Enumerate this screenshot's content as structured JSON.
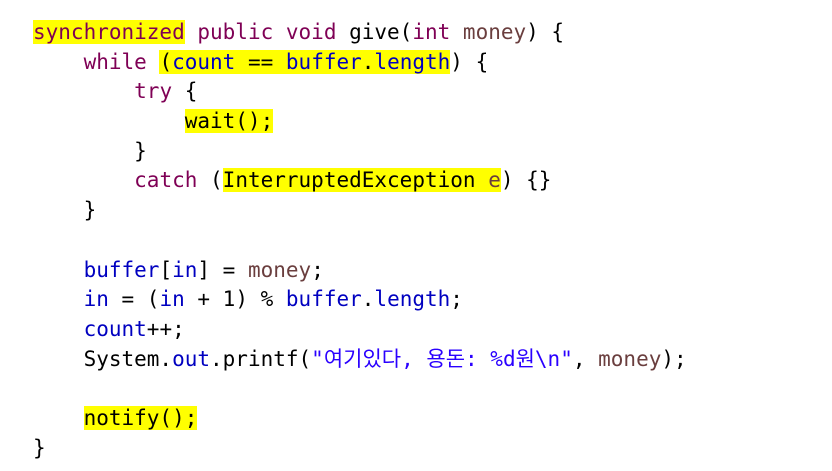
{
  "code": {
    "lines": [
      [
        {
          "text": "synchronized",
          "type": "kw",
          "hl": true
        },
        {
          "text": " ",
          "type": "plain"
        },
        {
          "text": "public",
          "type": "kw"
        },
        {
          "text": " ",
          "type": "plain"
        },
        {
          "text": "void",
          "type": "kw"
        },
        {
          "text": " give(",
          "type": "plain"
        },
        {
          "text": "int",
          "type": "kw"
        },
        {
          "text": " ",
          "type": "plain"
        },
        {
          "text": "money",
          "type": "var"
        },
        {
          "text": ") {",
          "type": "plain"
        }
      ],
      [
        {
          "text": "    ",
          "type": "plain"
        },
        {
          "text": "while",
          "type": "kw"
        },
        {
          "text": " ",
          "type": "plain"
        },
        {
          "text": "(",
          "type": "plain",
          "hl": true
        },
        {
          "text": "count",
          "type": "field",
          "hl": true
        },
        {
          "text": " == ",
          "type": "plain",
          "hl": true
        },
        {
          "text": "buffer",
          "type": "field",
          "hl": true
        },
        {
          "text": ".",
          "type": "plain",
          "hl": true
        },
        {
          "text": "length",
          "type": "field",
          "hl": true
        },
        {
          "text": ") {",
          "type": "plain"
        }
      ],
      [
        {
          "text": "        ",
          "type": "plain"
        },
        {
          "text": "try",
          "type": "kw"
        },
        {
          "text": " {",
          "type": "plain"
        }
      ],
      [
        {
          "text": "            ",
          "type": "plain"
        },
        {
          "text": "wait();",
          "type": "plain",
          "hl": true
        }
      ],
      [
        {
          "text": "        }",
          "type": "plain"
        }
      ],
      [
        {
          "text": "        ",
          "type": "plain"
        },
        {
          "text": "catch",
          "type": "kw"
        },
        {
          "text": " (",
          "type": "plain"
        },
        {
          "text": "InterruptedException ",
          "type": "plain",
          "hl": true
        },
        {
          "text": "e",
          "type": "var",
          "hl": true
        },
        {
          "text": ") {}",
          "type": "plain"
        }
      ],
      [
        {
          "text": "    }",
          "type": "plain"
        }
      ],
      [],
      [
        {
          "text": "    ",
          "type": "plain"
        },
        {
          "text": "buffer",
          "type": "field"
        },
        {
          "text": "[",
          "type": "plain"
        },
        {
          "text": "in",
          "type": "field"
        },
        {
          "text": "] = ",
          "type": "plain"
        },
        {
          "text": "money",
          "type": "var"
        },
        {
          "text": ";",
          "type": "plain"
        }
      ],
      [
        {
          "text": "    ",
          "type": "plain"
        },
        {
          "text": "in",
          "type": "field"
        },
        {
          "text": " = (",
          "type": "plain"
        },
        {
          "text": "in",
          "type": "field"
        },
        {
          "text": " + 1) % ",
          "type": "plain"
        },
        {
          "text": "buffer",
          "type": "field"
        },
        {
          "text": ".",
          "type": "plain"
        },
        {
          "text": "length",
          "type": "field"
        },
        {
          "text": ";",
          "type": "plain"
        }
      ],
      [
        {
          "text": "    ",
          "type": "plain"
        },
        {
          "text": "count",
          "type": "field"
        },
        {
          "text": "++;",
          "type": "plain"
        }
      ],
      [
        {
          "text": "    System.",
          "type": "plain"
        },
        {
          "text": "out",
          "type": "field"
        },
        {
          "text": ".printf(",
          "type": "plain"
        },
        {
          "text": "\"여기있다, 용돈: %d원\\n\"",
          "type": "str"
        },
        {
          "text": ", ",
          "type": "plain"
        },
        {
          "text": "money",
          "type": "var"
        },
        {
          "text": ");",
          "type": "plain"
        }
      ],
      [],
      [
        {
          "text": "    ",
          "type": "plain"
        },
        {
          "text": "notify();",
          "type": "plain",
          "hl": true
        }
      ],
      [
        {
          "text": "}",
          "type": "plain"
        }
      ]
    ]
  },
  "colors": {
    "keyword": "#7f0055",
    "field": "#0000c0",
    "variable": "#6a3e3e",
    "string": "#2a00ff",
    "highlight": "#ffff00"
  }
}
